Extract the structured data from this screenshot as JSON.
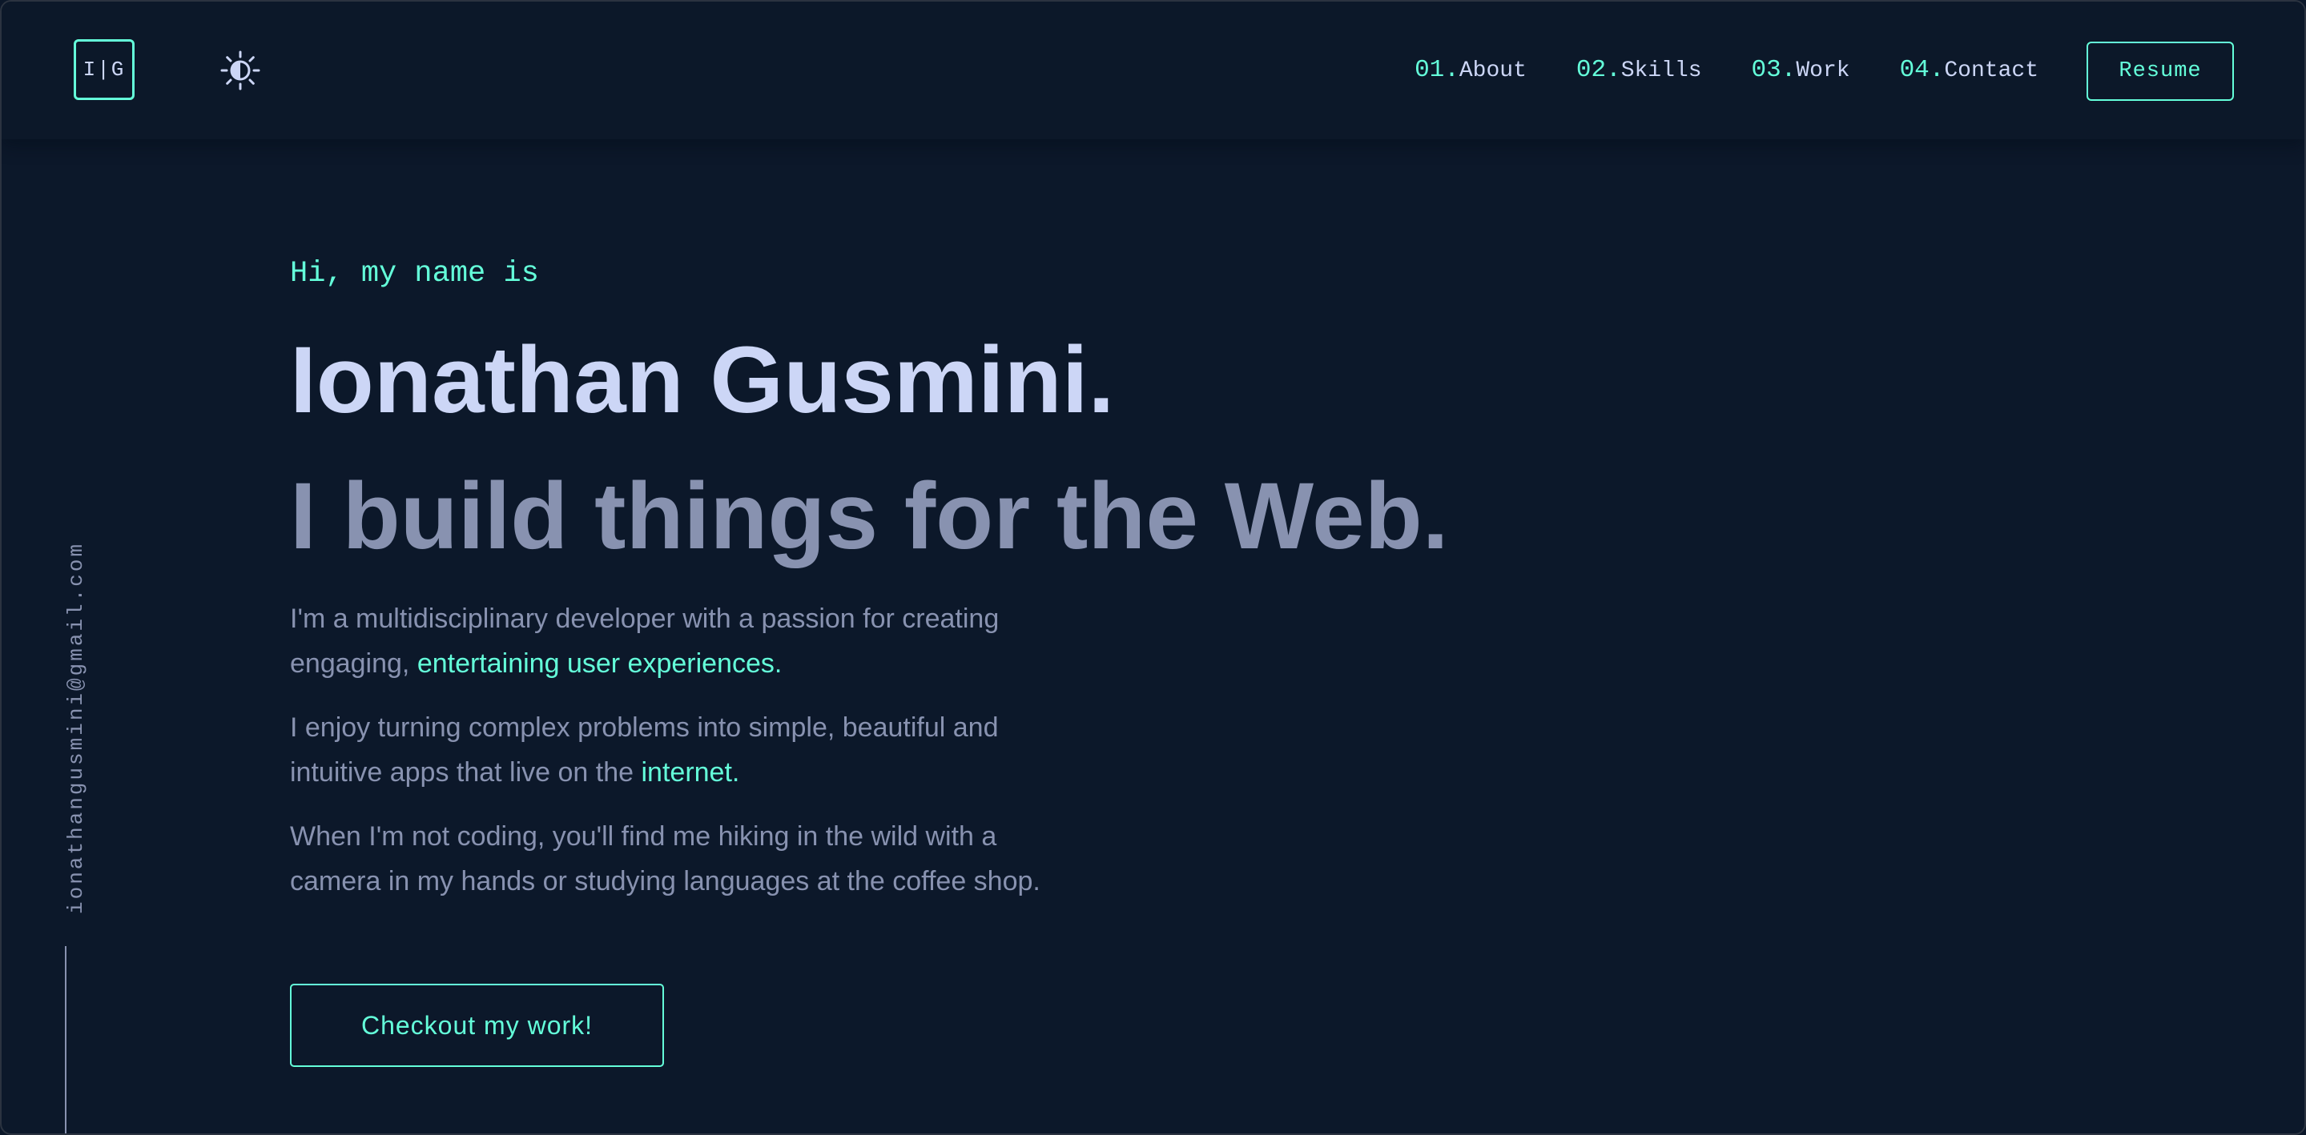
{
  "header": {
    "logo_text": "I|G",
    "theme_toggle_icon": "sun-half-icon",
    "nav": [
      {
        "num": "01.",
        "label": "About"
      },
      {
        "num": "02.",
        "label": "Skills"
      },
      {
        "num": "03.",
        "label": "Work"
      },
      {
        "num": "04.",
        "label": "Contact"
      }
    ],
    "resume_label": "Resume"
  },
  "sidebar": {
    "email": "ionathangusmini@gmail.com"
  },
  "hero": {
    "greeting": "Hi, my name is",
    "name": "Ionathan Gusmini.",
    "tagline": "I build things for the Web.",
    "paragraph1_before": "I'm a multidisciplinary developer with a passion for creating engaging, ",
    "paragraph1_highlight": "entertaining user experiences.",
    "paragraph2_before": "I enjoy turning complex problems into simple, beautiful and intuitive apps that live on the ",
    "paragraph2_highlight": "internet.",
    "paragraph3": "When I'm not coding, you'll find me hiking in the wild with a camera in my hands or studying languages at the coffee shop.",
    "cta_label": "Checkout my work!"
  },
  "colors": {
    "background": "#0c182a",
    "accent": "#64ffda",
    "heading": "#ccd6f6",
    "text": "#8892b0"
  }
}
